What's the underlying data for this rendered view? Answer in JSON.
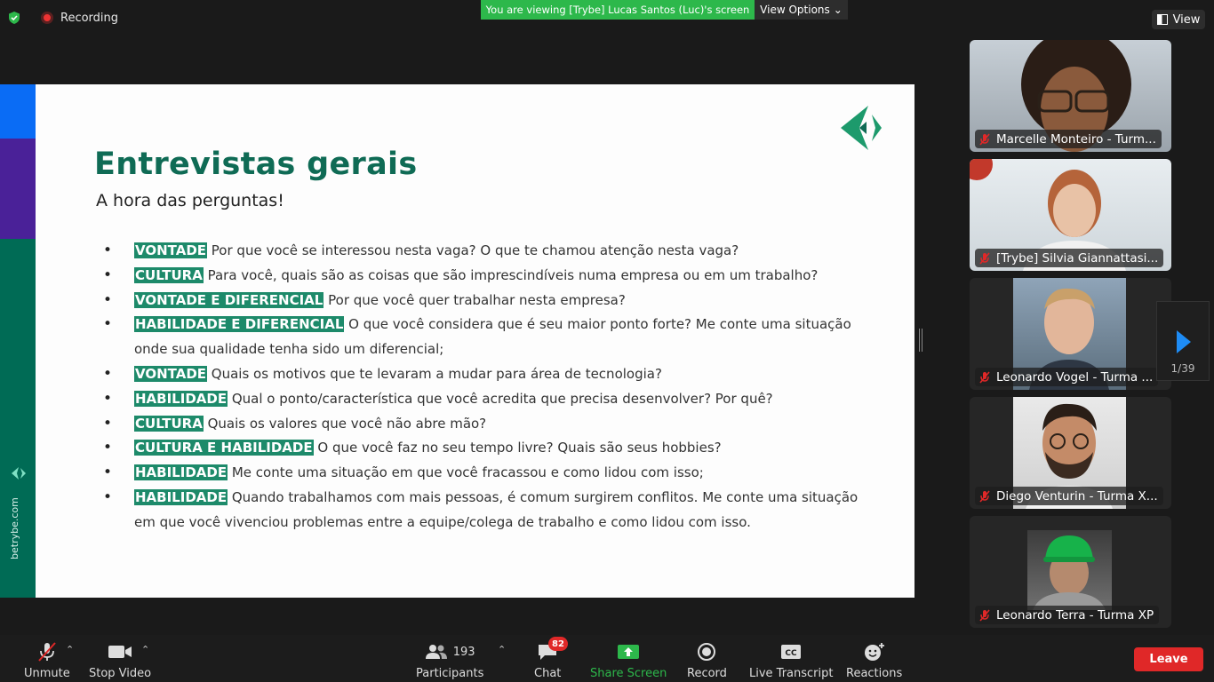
{
  "top": {
    "recording_label": "Recording",
    "viewing_banner": "You are viewing [Trybe] Lucas Santos (Luc)'s screen",
    "view_options_label": "View Options",
    "view_label": "View"
  },
  "slide": {
    "title": "Entrevistas gerais",
    "subtitle": "A hora das perguntas!",
    "side_url": "betrybe.com",
    "bullets": [
      {
        "tag": "VONTADE",
        "text": " Por que você se interessou nesta vaga? O que te chamou atenção nesta vaga?"
      },
      {
        "tag": "CULTURA",
        "text": " Para você, quais são as coisas que são imprescindíveis numa empresa ou em um trabalho?"
      },
      {
        "tag": "VONTADE E DIFERENCIAL",
        "text": " Por que você quer trabalhar nesta empresa?"
      },
      {
        "tag": "HABILIDADE E DIFERENCIAL",
        "text": " O que você considera que é seu maior ponto forte? Me conte uma situação onde sua qualidade tenha sido um diferencial;"
      },
      {
        "tag": "VONTADE",
        "text": " Quais os motivos que te levaram a mudar para área de tecnologia?"
      },
      {
        "tag": "HABILIDADE",
        "text": " Qual o ponto/característica que você acredita que precisa desenvolver? Por quê?"
      },
      {
        "tag": "CULTURA",
        "text": " Quais os valores que você não abre mão?"
      },
      {
        "tag": "CULTURA E HABILIDADE",
        "text": " O que você faz no seu tempo livre? Quais são seus hobbies?"
      },
      {
        "tag": "HABILIDADE",
        "text": " Me conte uma situação em que você fracassou e como lidou com isso;"
      },
      {
        "tag": "HABILIDADE",
        "text": " Quando trabalhamos com mais pessoas, é comum surgirem conflitos. Me conte uma situação em que você vivenciou problemas entre a equipe/colega de trabalho e como lidou com isso."
      }
    ]
  },
  "participants": [
    {
      "name": "Marcelle Monteiro - Turm..."
    },
    {
      "name": "[Trybe] Silvia Giannattasi..."
    },
    {
      "name": "Leonardo Vogel - Turma ..."
    },
    {
      "name": "Diego Venturin - Turma X..."
    },
    {
      "name": "Leonardo Terra - Turma XP"
    }
  ],
  "gallery_page": "1/39",
  "toolbar": {
    "unmute": "Unmute",
    "stop_video": "Stop Video",
    "participants_label": "Participants",
    "participants_count": "193",
    "chat": "Chat",
    "chat_badge": "82",
    "share_screen": "Share Screen",
    "record": "Record",
    "live_transcript": "Live Transcript",
    "reactions": "Reactions",
    "leave": "Leave"
  },
  "colors": {
    "share_green": "#2db84b",
    "leave_red": "#e02828",
    "tag_green": "#1d8a6a",
    "title_green": "#0f6b55"
  }
}
